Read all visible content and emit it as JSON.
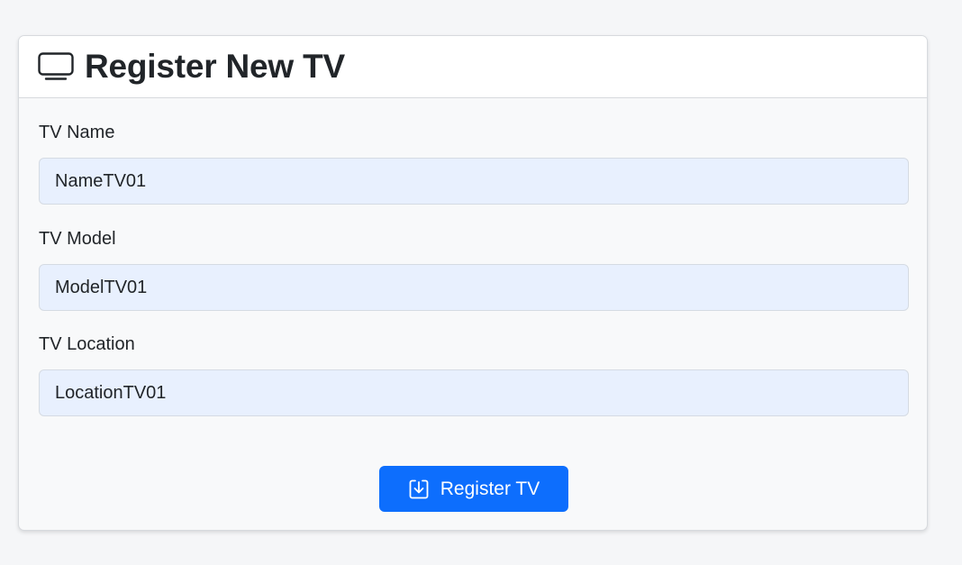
{
  "header": {
    "title": "Register New TV",
    "icon": "tv-icon"
  },
  "form": {
    "fields": [
      {
        "label": "TV Name",
        "value": "NameTV01"
      },
      {
        "label": "TV Model",
        "value": "ModelTV01"
      },
      {
        "label": "TV Location",
        "value": "LocationTV01"
      }
    ],
    "submit": {
      "label": "Register TV",
      "icon": "download-box-icon"
    }
  },
  "colors": {
    "accent": "#0d6efd",
    "input_bg": "#e8f0fe",
    "page_bg": "#f5f6f8"
  }
}
